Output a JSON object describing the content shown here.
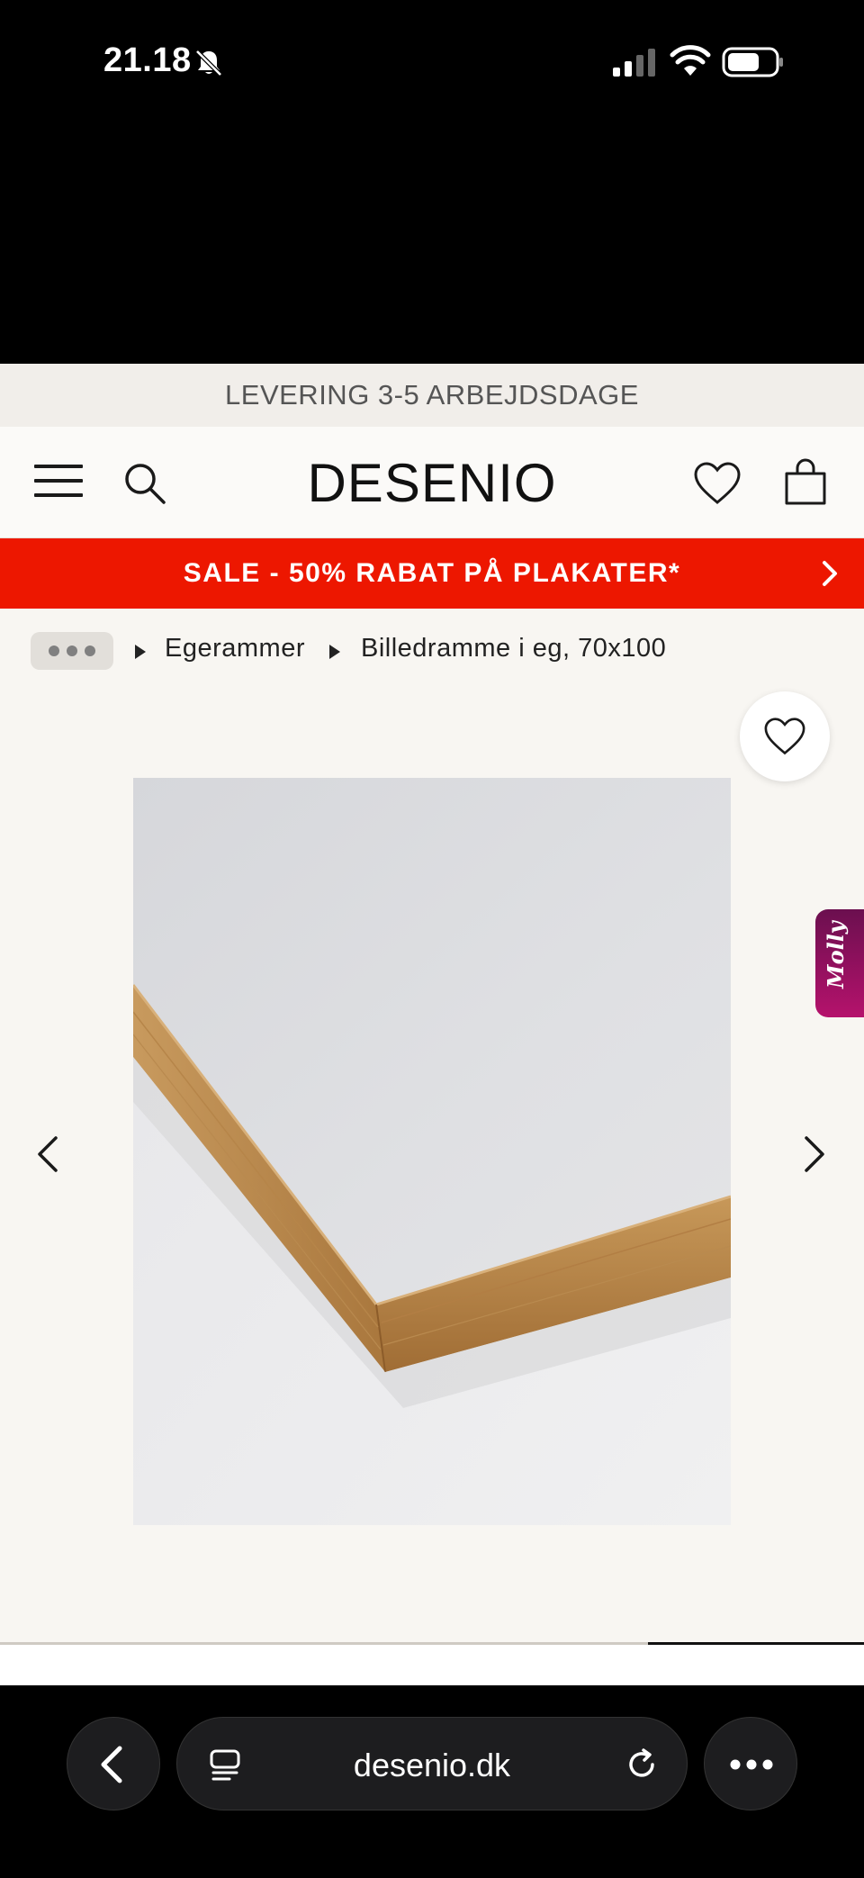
{
  "status_bar": {
    "time": "21.18",
    "icons": [
      "bell-slash-icon",
      "cellular-signal-icon",
      "wifi-icon",
      "battery-icon"
    ]
  },
  "announcement": {
    "text": "LEVERING 3-5 ARBEJDSDAGE"
  },
  "header": {
    "logo": "DESENIO",
    "icons": [
      "menu-icon",
      "search-icon",
      "wishlist-heart-icon",
      "shopping-bag-icon"
    ]
  },
  "sale_banner": {
    "text": "SALE - 50% RABAT PÅ PLAKATER*",
    "color": "#ed1700"
  },
  "breadcrumb": {
    "items": [
      {
        "label": "Egerammer"
      },
      {
        "label": "Billedramme i eg, 70x100"
      }
    ]
  },
  "gallery": {
    "image_subject": "oak picture frame corner",
    "progress_fraction": 0.25
  },
  "chat_widget": {
    "label": "Molly"
  },
  "browser": {
    "url": "desenio.dk"
  }
}
